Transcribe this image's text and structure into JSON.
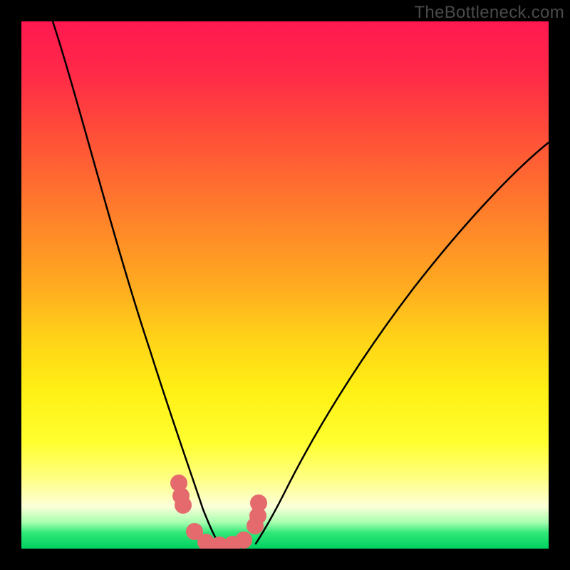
{
  "watermark": "TheBottleneck.com",
  "chart_data": {
    "type": "line",
    "title": "",
    "xlabel": "",
    "ylabel": "",
    "xlim": [
      0,
      100
    ],
    "ylim": [
      0,
      100
    ],
    "series": [
      {
        "name": "left-curve",
        "x": [
          6,
          10,
          15,
          20,
          24,
          27,
          29.5,
          31.5,
          33,
          34.5,
          36,
          37.5
        ],
        "y": [
          100,
          85,
          68,
          50,
          35,
          23,
          14,
          7.5,
          4,
          2,
          1,
          0.5
        ]
      },
      {
        "name": "right-curve",
        "x": [
          44.5,
          46,
          48,
          51,
          55,
          60,
          67,
          75,
          85,
          95,
          100
        ],
        "y": [
          0.5,
          2,
          5,
          10,
          18,
          27,
          39,
          50,
          62,
          72,
          77
        ]
      },
      {
        "name": "bottom-markers",
        "x": [
          29.8,
          30.3,
          30.6,
          32.8,
          35.0,
          37.5,
          40.0,
          42.2,
          44.3,
          44.8,
          44.9
        ],
        "y": [
          12.4,
          10.0,
          8.3,
          3.2,
          1.2,
          0.7,
          0.8,
          1.6,
          4.3,
          6.2,
          8.7
        ]
      }
    ],
    "colors": {
      "curve": "#000000",
      "markers": "#e46a6e"
    }
  }
}
